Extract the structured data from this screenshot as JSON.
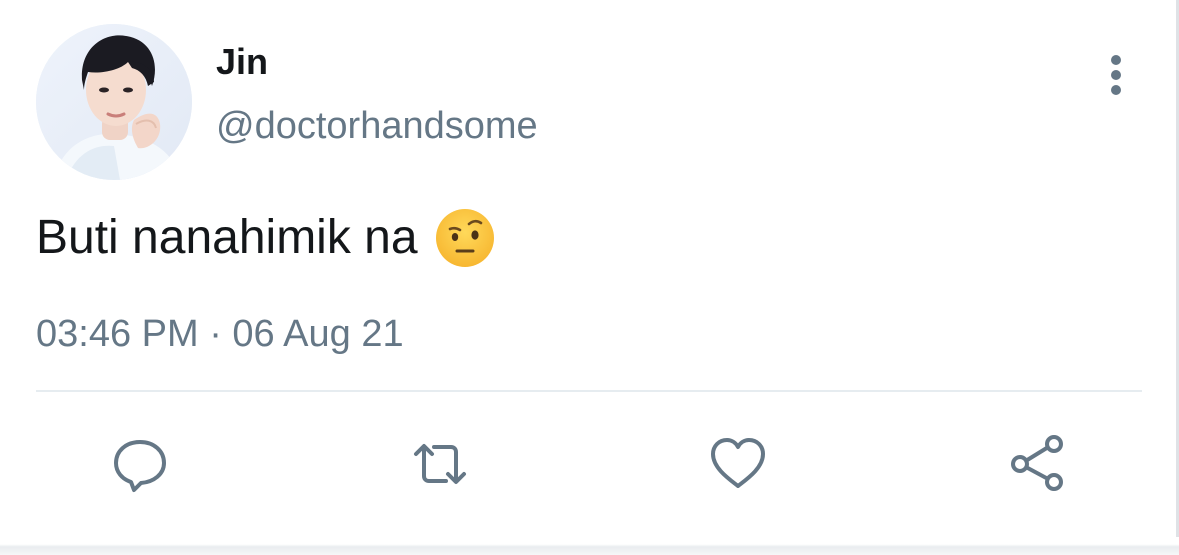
{
  "tweet": {
    "author_name": "Jin",
    "author_handle": "@doctorhandsome",
    "text": "Buti nanahimik na",
    "emoji": "face-with-raised-eyebrow",
    "timestamp": "03:46 PM · 06 Aug 21"
  },
  "actions": [
    {
      "name": "reply",
      "icon": "speech-bubble-icon"
    },
    {
      "name": "retweet",
      "icon": "retweet-arrows-icon"
    },
    {
      "name": "like",
      "icon": "heart-icon"
    },
    {
      "name": "share",
      "icon": "share-nodes-icon"
    }
  ],
  "colors": {
    "text_primary": "#14171a",
    "text_secondary": "#657786",
    "icon": "#657786",
    "divider": "#e6ecf0"
  }
}
